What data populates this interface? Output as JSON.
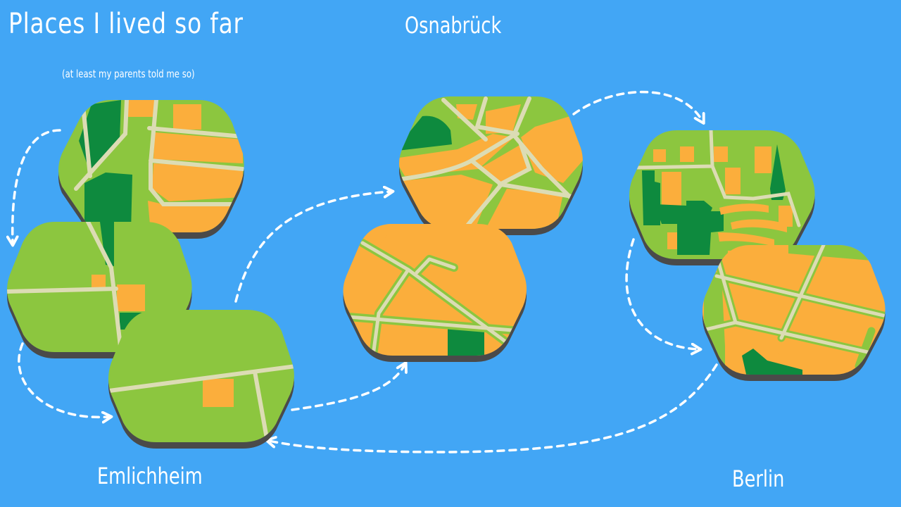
{
  "title": "Places I lived so far",
  "subtitle": "(at least my parents told me so)",
  "cities": {
    "osnabrueck": "Osnabrück",
    "emlichheim": "Emlichheim",
    "berlin": "Berlin"
  },
  "colors": {
    "water": "#42a6f5",
    "grass": "#8cc63f",
    "forest": "#0e8a3e",
    "buildings": "#fbae3c",
    "roads": "#dcdcb4",
    "tile_shadow": "#4a4a4a",
    "arrows": "#ffffff"
  }
}
